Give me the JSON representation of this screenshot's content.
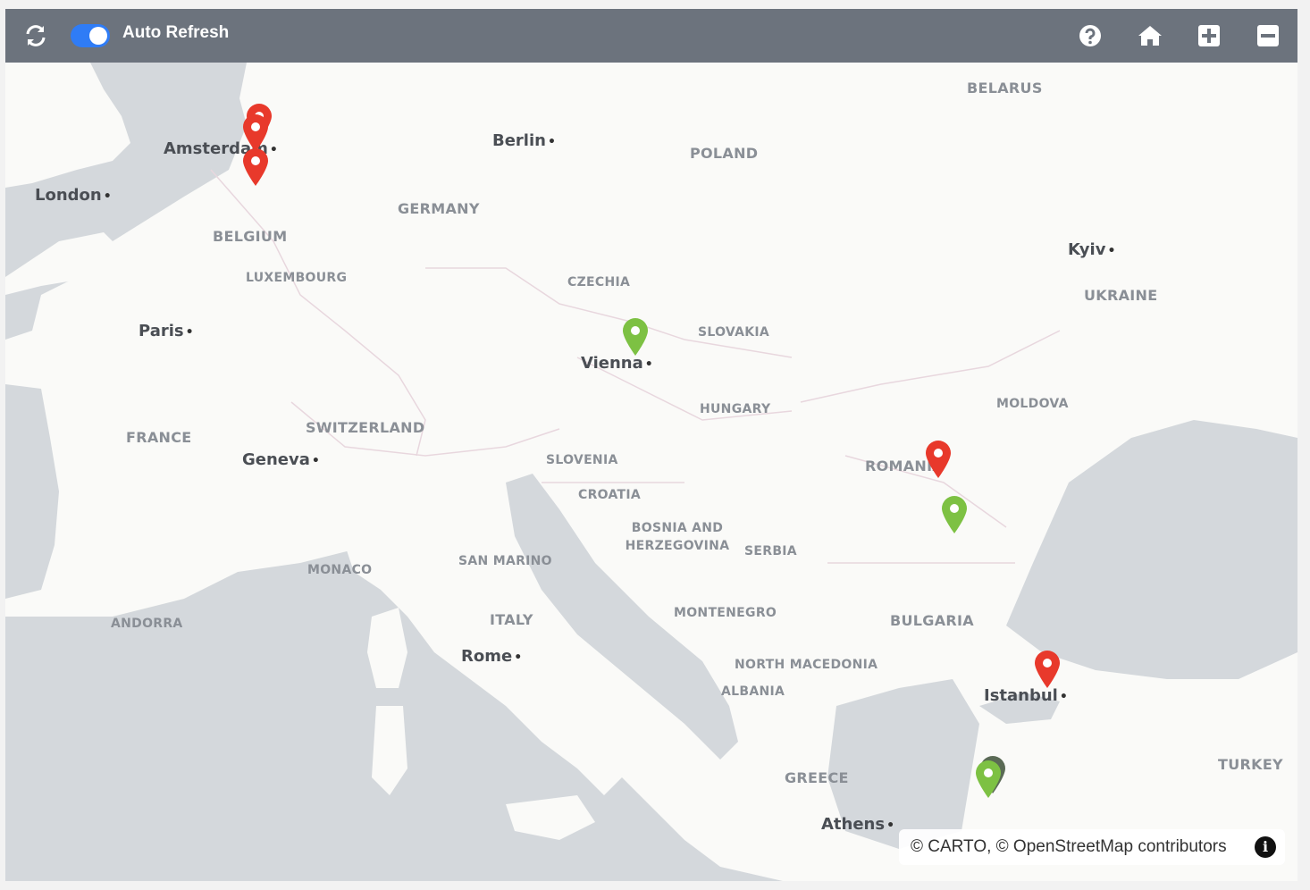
{
  "toolbar": {
    "auto_refresh_label": "Auto Refresh",
    "auto_refresh_on": true,
    "icons": [
      "refresh-icon",
      "help-icon",
      "home-icon",
      "zoom-in-icon",
      "zoom-out-icon"
    ]
  },
  "map": {
    "countries": [
      "BELARUS",
      "POLAND",
      "GERMANY",
      "BELGIUM",
      "LUXEMBOURG",
      "CZECHIA",
      "SLOVAKIA",
      "UKRAINE",
      "MOLDOVA",
      "HUNGARY",
      "FRANCE",
      "SWITZERLAND",
      "SLOVENIA",
      "CROATIA",
      "ROMANIA",
      "BOSNIA AND HERZEGOVINA",
      "SERBIA",
      "SAN MARINO",
      "MONACO",
      "ANDORRA",
      "ITALY",
      "MONTENEGRO",
      "BULGARIA",
      "NORTH MACEDONIA",
      "ALBANIA",
      "GREECE",
      "TURKEY"
    ],
    "cities": [
      "Amsterdam",
      "Berlin",
      "London",
      "Kyiv",
      "Paris",
      "Vienna",
      "Geneva",
      "Rome",
      "Istanbul",
      "Athens"
    ],
    "markers": [
      {
        "place": "Amsterdam",
        "status": "red"
      },
      {
        "place": "Amsterdam",
        "status": "red"
      },
      {
        "place": "Rotterdam",
        "status": "red"
      },
      {
        "place": "Vienna",
        "status": "green"
      },
      {
        "place": "Romania (north)",
        "status": "red"
      },
      {
        "place": "Romania (south)",
        "status": "green"
      },
      {
        "place": "Istanbul",
        "status": "red"
      },
      {
        "place": "Izmir",
        "status": "green"
      }
    ],
    "colors": {
      "red": "#e8392b",
      "green": "#7dc143",
      "water": "#d4d8dc",
      "land": "#fafaf8",
      "toolbar": "#6c737d"
    }
  },
  "attribution": "© CARTO, © OpenStreetMap contributors"
}
